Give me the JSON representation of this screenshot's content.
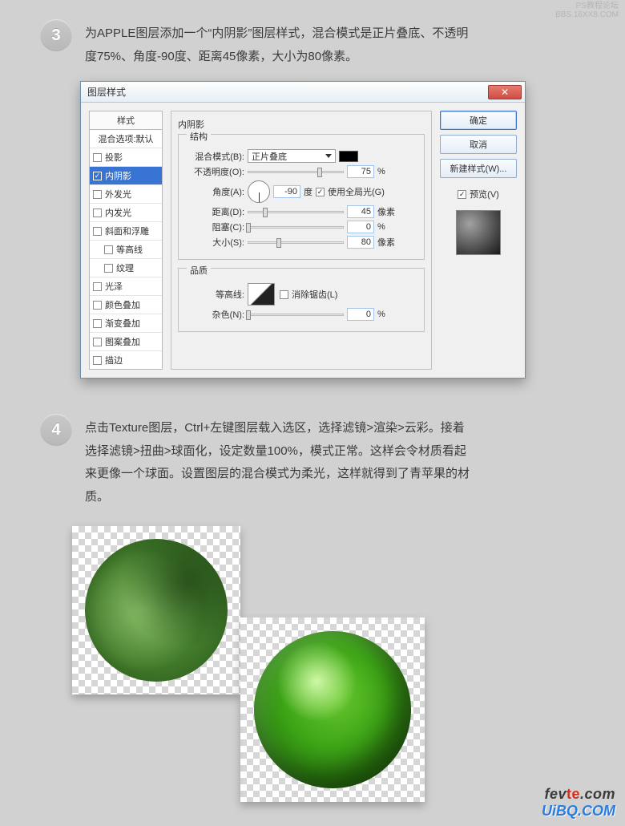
{
  "watermarks": {
    "top_line1": "PS教程论坛",
    "top_line2": "BBS.16XX8.COM",
    "bottom_line1_a": "fev",
    "bottom_line1_b": "te",
    "bottom_line1_c": ".com",
    "bottom_line2": "UiBQ.COM"
  },
  "step3": {
    "number": "3",
    "text": "为APPLE图层添加一个“内阴影”图层样式，混合模式是正片叠底、不透明度75%、角度-90度、距离45像素，大小为80像素。"
  },
  "step4": {
    "number": "4",
    "text": "点击Texture图层，Ctrl+左键图层载入选区，选择滤镜>渲染>云彩。接着选择滤镜>扭曲>球面化，设定数量100%，模式正常。这样会令材质看起来更像一个球面。设置图层的混合模式为柔光，这样就得到了青苹果的材质。"
  },
  "dialog": {
    "title": "图层样式",
    "close_x": "✕",
    "styles_header": "样式",
    "styles": {
      "defaults": "混合选项:默认",
      "drop_shadow": "投影",
      "inner_shadow": "内阴影",
      "outer_glow": "外发光",
      "inner_glow": "内发光",
      "bevel": "斜面和浮雕",
      "contour": "等高线",
      "texture": "纹理",
      "satin": "光泽",
      "color_overlay": "颜色叠加",
      "grad_overlay": "渐变叠加",
      "pattern_overlay": "图案叠加",
      "stroke": "描边"
    },
    "section_title": "内阴影",
    "group_structure": "结构",
    "group_quality": "品质",
    "labels": {
      "blend_mode": "混合模式(B):",
      "opacity": "不透明度(O):",
      "angle": "角度(A):",
      "distance": "距离(D):",
      "choke": "阻塞(C):",
      "size": "大小(S):",
      "contour_l": "等高线:",
      "antialias": "消除锯齿(L)",
      "noise": "杂色(N):",
      "global_light": "使用全局光(G)"
    },
    "values": {
      "blend_mode": "正片叠底",
      "opacity": "75",
      "angle": "-90",
      "angle_unit": "度",
      "distance": "45",
      "distance_unit": "像素",
      "choke": "0",
      "choke_unit": "%",
      "size": "80",
      "size_unit": "像素",
      "noise": "0",
      "noise_unit": "%",
      "opacity_unit": "%"
    },
    "buttons": {
      "ok": "确定",
      "cancel": "取消",
      "new_style": "新建样式(W)...",
      "preview": "预览(V)"
    }
  }
}
